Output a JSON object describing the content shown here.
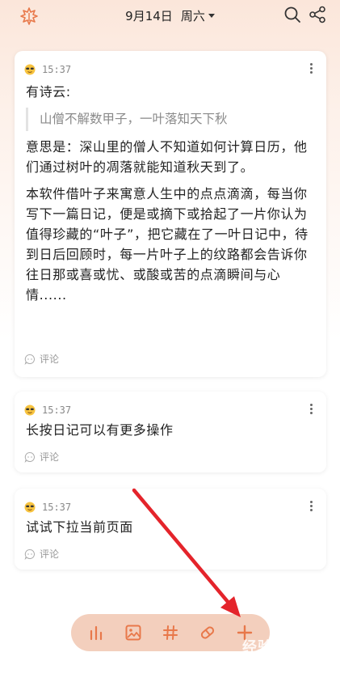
{
  "header": {
    "date": "9月14日",
    "weekday": "周六",
    "logo_icon": "leaf-icon",
    "accent": "#e8784a"
  },
  "entries": [
    {
      "time": "15:37",
      "mood_icon": "cool-face-emoji",
      "intro": "有诗云:",
      "quote": "山僧不解数甲子，一叶落知天下秋",
      "para1": "意思是：深山里的僧人不知道如何计算日历，他们通过树叶的凋落就能知道秋天到了。",
      "para2": "本软件借叶子来寓意人生中的点点滴滴，每当你写下一篇日记，便是或摘下或拾起了一片你认为值得珍藏的“叶子”，把它藏在了一叶日记中，待到日后回顾时，每一片叶子上的纹路都会告诉你往日那或喜或忧、或酸或苦的点滴瞬间与心情......",
      "comment": "评论"
    },
    {
      "time": "15:37",
      "mood_icon": "cool-face-emoji",
      "text": "长按日记可以有更多操作",
      "comment": "评论"
    },
    {
      "time": "15:37",
      "mood_icon": "cool-face-emoji",
      "text": "试试下拉当前页面",
      "comment": "评论"
    }
  ],
  "toolbar": {
    "items": [
      "stats-icon",
      "image-icon",
      "hashtag-icon",
      "eraser-icon",
      "add-icon"
    ]
  },
  "watermark": "经验"
}
